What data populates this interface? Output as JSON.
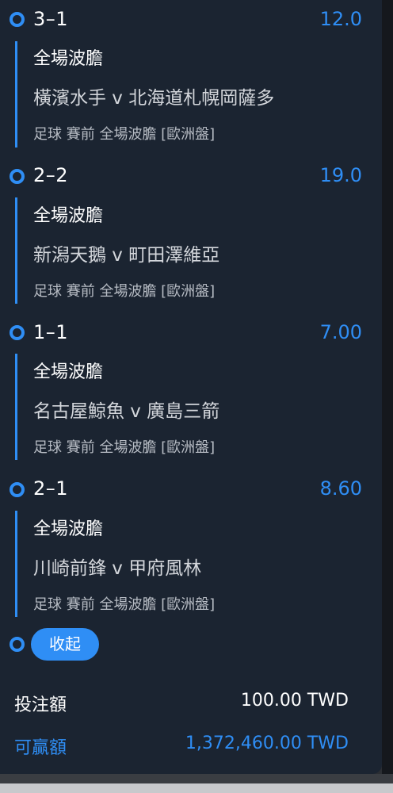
{
  "bets": [
    {
      "selection": "3–1",
      "odds": "12.0",
      "market": "全場波膽",
      "match": "橫濱水手 v 北海道札幌岡薩多",
      "meta": "足球 賽前  全場波膽 [歐洲盤]"
    },
    {
      "selection": "2–2",
      "odds": "19.0",
      "market": "全場波膽",
      "match": "新潟天鵝 v 町田澤維亞",
      "meta": "足球 賽前  全場波膽 [歐洲盤]"
    },
    {
      "selection": "1–1",
      "odds": "7.00",
      "market": "全場波膽",
      "match": "名古屋鯨魚 v 廣島三箭",
      "meta": "足球 賽前  全場波膽 [歐洲盤]"
    },
    {
      "selection": "2–1",
      "odds": "8.60",
      "market": "全場波膽",
      "match": "川崎前鋒 v 甲府風林",
      "meta": "足球 賽前  全場波膽 [歐洲盤]"
    }
  ],
  "collapse_label": "收起",
  "summary": {
    "stake_label": "投注額",
    "stake_value": "100.00 TWD",
    "win_label": "可贏額",
    "win_value": "1,372,460.00 TWD"
  },
  "colors": {
    "accent": "#2f8ef5",
    "panel": "#1b2431",
    "text": "#ffffff"
  }
}
